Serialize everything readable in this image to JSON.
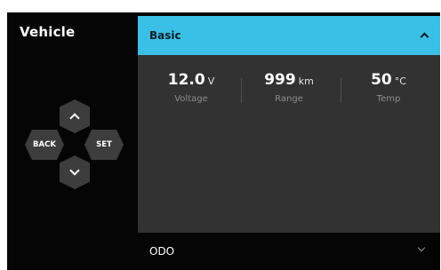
{
  "app": {
    "title": "Vehicle"
  },
  "dpad": {
    "back_label": "BACK",
    "set_label": "SET",
    "up_icon": "chevron-up-icon",
    "down_icon": "chevron-down-icon"
  },
  "basic_panel": {
    "title": "Basic",
    "expanded": true,
    "header_color": "#3ac0e6",
    "stats": [
      {
        "value": "12.0",
        "unit": "V",
        "label": "Voltage"
      },
      {
        "value": "999",
        "unit": "km",
        "label": "Range"
      },
      {
        "value": "50",
        "unit": "°C",
        "label": "Temp"
      }
    ]
  },
  "odo_panel": {
    "title": "ODO",
    "expanded": false
  }
}
